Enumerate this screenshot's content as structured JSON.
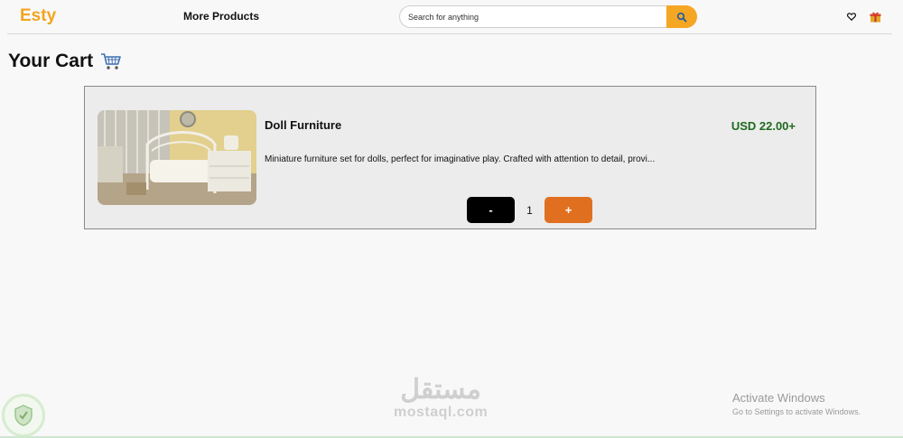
{
  "header": {
    "logo": "Esty",
    "nav_more_products": "More Products",
    "search_placeholder": "Search for anything",
    "icons": [
      "search-icon",
      "heart-icon",
      "gift-icon"
    ]
  },
  "page": {
    "title": "Your Cart",
    "title_icon": "cart-icon"
  },
  "cart": {
    "items": [
      {
        "name": "Doll Furniture",
        "price": "USD 22.00+",
        "description": "Miniature furniture set for dolls, perfect for imaginative play. Crafted with attention to detail, provi...",
        "quantity": "1",
        "minus_label": "-",
        "plus_label": "+"
      }
    ]
  },
  "overlay": {
    "watermark_arabic": "مستقل",
    "watermark_domain": "mostaql.com",
    "activate_title": "Activate Windows",
    "activate_sub": "Go to Settings to activate Windows."
  },
  "colors": {
    "brand": "#f2a51f",
    "search_button": "#f5a623",
    "price": "#1e6b1e",
    "plus_button": "#e07020",
    "minus_button": "#000000"
  }
}
